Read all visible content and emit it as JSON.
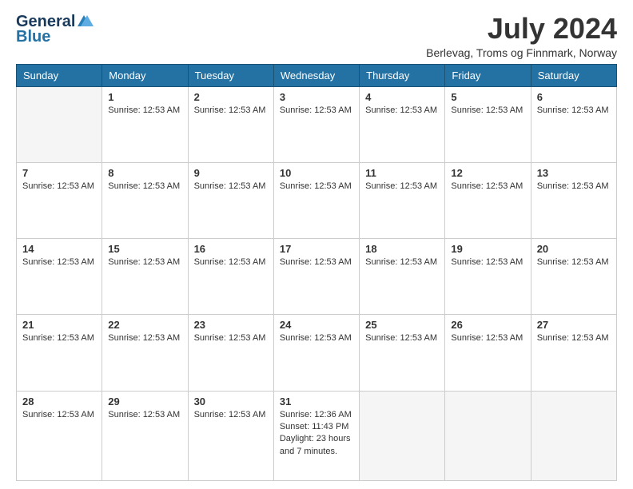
{
  "header": {
    "logo_line1": "General",
    "logo_line2": "Blue",
    "month_year": "July 2024",
    "location": "Berlevag, Troms og Finnmark, Norway"
  },
  "days_of_week": [
    "Sunday",
    "Monday",
    "Tuesday",
    "Wednesday",
    "Thursday",
    "Friday",
    "Saturday"
  ],
  "weeks": [
    [
      {
        "day": "",
        "empty": true
      },
      {
        "day": "1",
        "sunrise": "Sunrise: 12:53 AM"
      },
      {
        "day": "2",
        "sunrise": "Sunrise: 12:53 AM"
      },
      {
        "day": "3",
        "sunrise": "Sunrise: 12:53 AM"
      },
      {
        "day": "4",
        "sunrise": "Sunrise: 12:53 AM"
      },
      {
        "day": "5",
        "sunrise": "Sunrise: 12:53 AM"
      },
      {
        "day": "6",
        "sunrise": "Sunrise: 12:53 AM"
      }
    ],
    [
      {
        "day": "7",
        "sunrise": "Sunrise: 12:53 AM"
      },
      {
        "day": "8",
        "sunrise": "Sunrise: 12:53 AM"
      },
      {
        "day": "9",
        "sunrise": "Sunrise: 12:53 AM"
      },
      {
        "day": "10",
        "sunrise": "Sunrise: 12:53 AM"
      },
      {
        "day": "11",
        "sunrise": "Sunrise: 12:53 AM"
      },
      {
        "day": "12",
        "sunrise": "Sunrise: 12:53 AM"
      },
      {
        "day": "13",
        "sunrise": "Sunrise: 12:53 AM"
      }
    ],
    [
      {
        "day": "14",
        "sunrise": "Sunrise: 12:53 AM"
      },
      {
        "day": "15",
        "sunrise": "Sunrise: 12:53 AM"
      },
      {
        "day": "16",
        "sunrise": "Sunrise: 12:53 AM"
      },
      {
        "day": "17",
        "sunrise": "Sunrise: 12:53 AM"
      },
      {
        "day": "18",
        "sunrise": "Sunrise: 12:53 AM"
      },
      {
        "day": "19",
        "sunrise": "Sunrise: 12:53 AM"
      },
      {
        "day": "20",
        "sunrise": "Sunrise: 12:53 AM"
      }
    ],
    [
      {
        "day": "21",
        "sunrise": "Sunrise: 12:53 AM"
      },
      {
        "day": "22",
        "sunrise": "Sunrise: 12:53 AM"
      },
      {
        "day": "23",
        "sunrise": "Sunrise: 12:53 AM"
      },
      {
        "day": "24",
        "sunrise": "Sunrise: 12:53 AM"
      },
      {
        "day": "25",
        "sunrise": "Sunrise: 12:53 AM"
      },
      {
        "day": "26",
        "sunrise": "Sunrise: 12:53 AM"
      },
      {
        "day": "27",
        "sunrise": "Sunrise: 12:53 AM"
      }
    ],
    [
      {
        "day": "28",
        "sunrise": "Sunrise: 12:53 AM"
      },
      {
        "day": "29",
        "sunrise": "Sunrise: 12:53 AM"
      },
      {
        "day": "30",
        "sunrise": "Sunrise: 12:53 AM"
      },
      {
        "day": "31",
        "sunrise": "Sunrise: 12:36 AM\nSunset: 11:43 PM\nDaylight: 23 hours and 7 minutes."
      },
      {
        "day": "",
        "empty": true
      },
      {
        "day": "",
        "empty": true
      },
      {
        "day": "",
        "empty": true
      }
    ]
  ]
}
